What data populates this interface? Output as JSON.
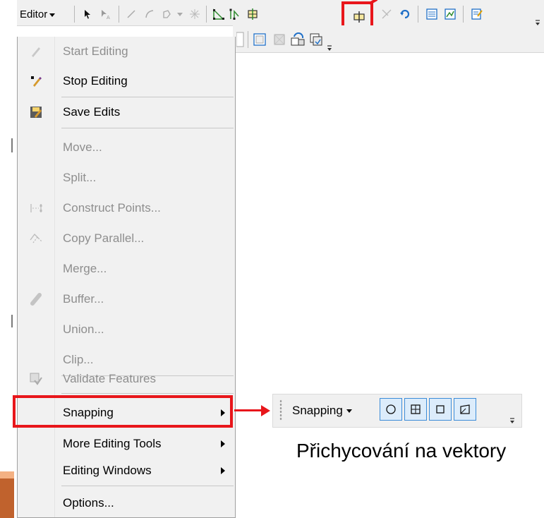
{
  "toolbar": {
    "editor_label": "Editor",
    "icons_row1": [
      "edit-tool-icon",
      "edit-annotation-icon",
      "straight-segment-icon",
      "end-point-arc-icon",
      "trace-icon",
      "point-icon",
      "edit-vertices-icon",
      "reshape-feature-icon",
      "cut-polygons-icon",
      "split-tool-icon",
      "rotate-tool-icon",
      "attributes-icon",
      "sketch-properties-icon",
      "create-features-icon"
    ],
    "icons_row2": [
      "topology-icon",
      "error-inspector-icon",
      "fix-tool-icon",
      "save-layers-icon"
    ]
  },
  "menu": {
    "items": [
      {
        "label": "Start Editing",
        "enabled": false,
        "icon": "pencil-icon"
      },
      {
        "label": "Stop Editing",
        "enabled": true,
        "icon": "stop-pencil-icon"
      },
      {
        "label": "Save Edits",
        "enabled": true,
        "icon": "save-edits-icon"
      },
      {
        "label": "Move...",
        "enabled": false,
        "icon": ""
      },
      {
        "label": "Split...",
        "enabled": false,
        "icon": ""
      },
      {
        "label": "Construct Points...",
        "enabled": false,
        "icon": "construct-points-icon"
      },
      {
        "label": "Copy Parallel...",
        "enabled": false,
        "icon": "copy-parallel-icon"
      },
      {
        "label": "Merge...",
        "enabled": false,
        "icon": ""
      },
      {
        "label": "Buffer...",
        "enabled": false,
        "icon": "buffer-icon"
      },
      {
        "label": "Union...",
        "enabled": false,
        "icon": ""
      },
      {
        "label": "Clip...",
        "enabled": false,
        "icon": ""
      },
      {
        "label": "Validate Features",
        "enabled": false,
        "icon": "validate-icon"
      },
      {
        "label": "Snapping",
        "enabled": true,
        "icon": "",
        "submenu": true
      },
      {
        "label": "More Editing Tools",
        "enabled": true,
        "icon": "",
        "submenu": true
      },
      {
        "label": "Editing Windows",
        "enabled": true,
        "icon": "",
        "submenu": true
      },
      {
        "label": "Options...",
        "enabled": true,
        "icon": ""
      }
    ]
  },
  "snapping_toolbar": {
    "label": "Snapping",
    "buttons": [
      "point-snapping-icon",
      "end-snapping-icon",
      "vertex-snapping-icon",
      "edge-snapping-icon"
    ]
  },
  "caption": "Přichycování na vektory",
  "colors": {
    "highlight": "#e8161b",
    "snap_button": "#dcecfb",
    "snap_border": "#3c8cd8"
  }
}
